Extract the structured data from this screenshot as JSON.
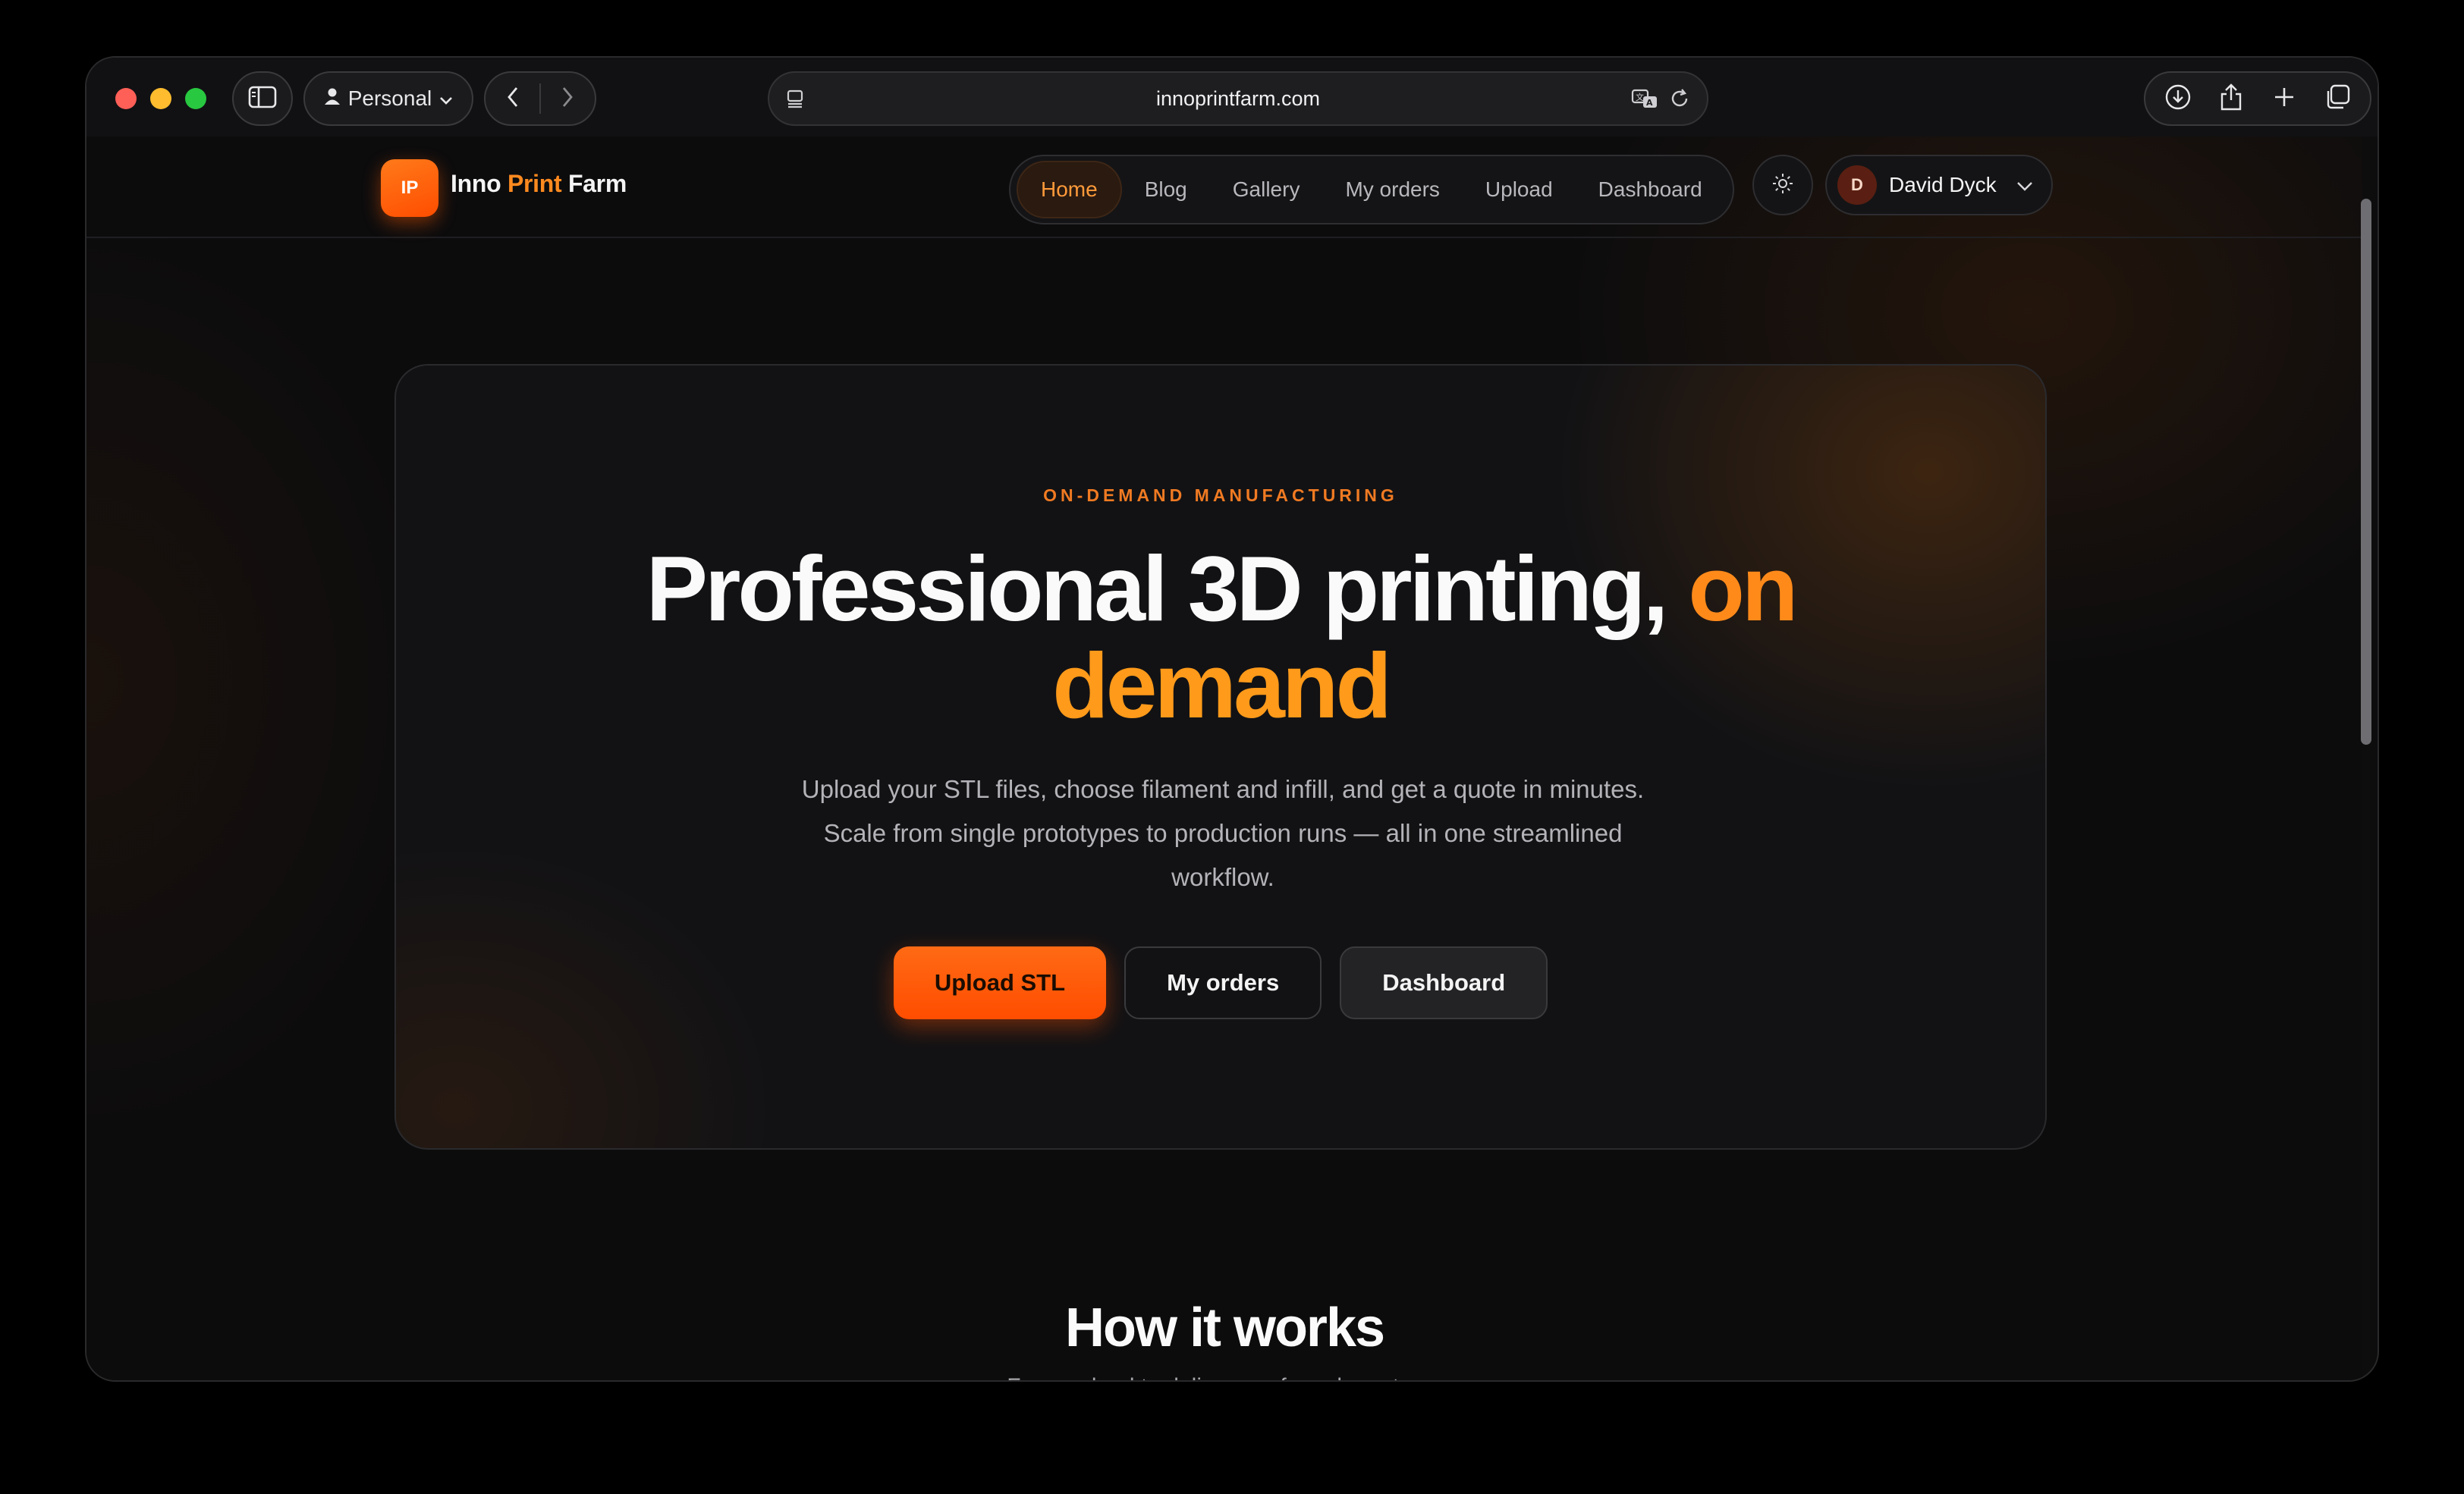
{
  "browser": {
    "profile_label": "Personal",
    "url": "innoprintfarm.com"
  },
  "site": {
    "logo_badge": "IP",
    "logo_word1": "Inno",
    "logo_word2": "Print",
    "logo_word3": "Farm",
    "nav": [
      {
        "label": "Home",
        "active": true
      },
      {
        "label": "Blog"
      },
      {
        "label": "Gallery"
      },
      {
        "label": "My orders"
      },
      {
        "label": "Upload"
      },
      {
        "label": "Dashboard"
      }
    ],
    "user": {
      "initial": "D",
      "name": "David Dyck"
    }
  },
  "hero": {
    "eyebrow": "ON-DEMAND MANUFACTURING",
    "headline_white": "Professional 3D printing,",
    "headline_orange1": "on",
    "headline_orange2": "demand",
    "subtitle": "Upload your STL files, choose filament and infill, and get a quote in minutes. Scale from single prototypes to production runs — all in one streamlined workflow.",
    "cta_primary": "Upload STL",
    "cta_orders": "My orders",
    "cta_dashboard": "Dashboard"
  },
  "how": {
    "title": "How it works",
    "subtitle": "From upload to delivery — four clear steps."
  },
  "colors": {
    "accent": "#ff6a14",
    "accent_text": "#ff8a1a",
    "background": "#0c0c0d"
  }
}
